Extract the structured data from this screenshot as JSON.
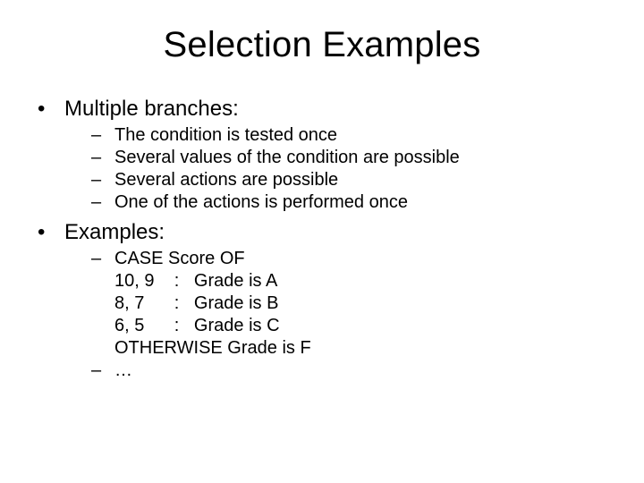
{
  "title": "Selection Examples",
  "s1": {
    "label": "Multiple branches:",
    "items": [
      "The condition is tested once",
      "Several values of the condition are possible",
      "Several actions are possible",
      "One of the actions is performed once"
    ]
  },
  "s2": {
    "label": "Examples:",
    "code": [
      "CASE Score OF",
      "10, 9    :   Grade is A",
      "8, 7      :   Grade is B",
      "6, 5      :   Grade is C",
      "OTHERWISE Grade is F"
    ],
    "ellipsis": "…"
  },
  "bullet": "•",
  "dash": "–"
}
